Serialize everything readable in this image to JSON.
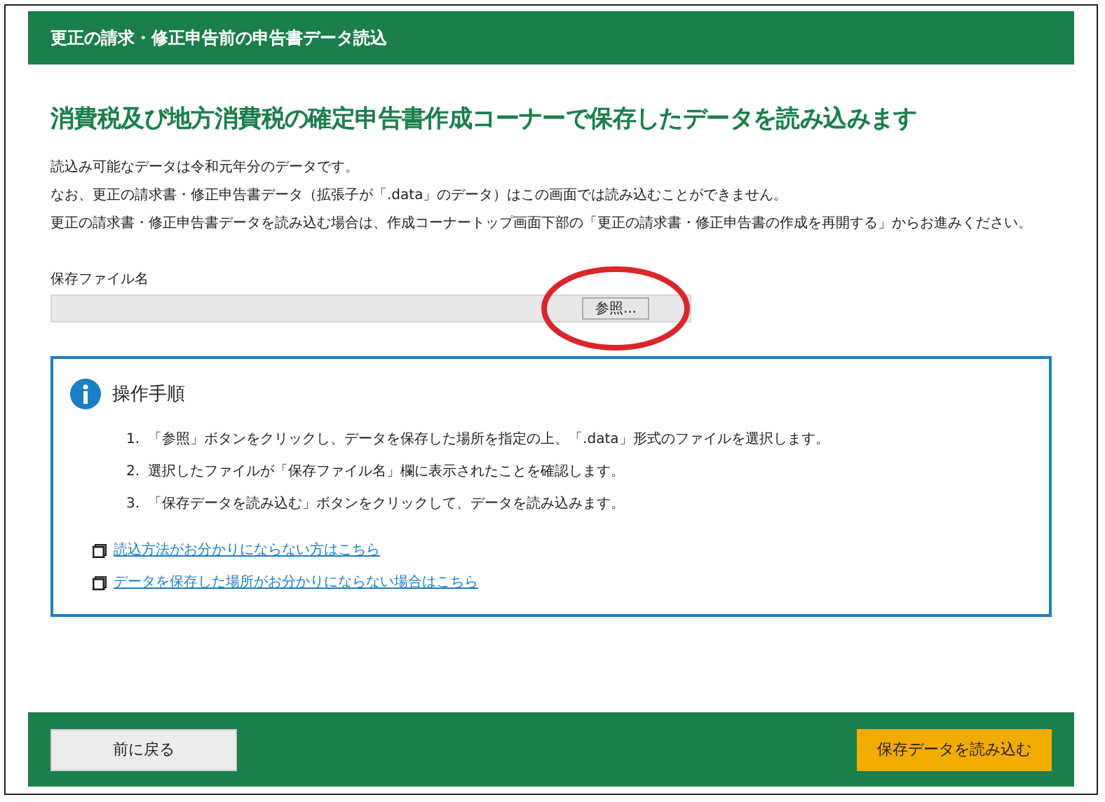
{
  "header": {
    "title": "更正の請求・修正申告前の申告書データ読込"
  },
  "heading": "消費税及び地方消費税の確定申告書作成コーナーで保存したデータを読み込みます",
  "notes": [
    "読込み可能なデータは令和元年分のデータです。",
    "なお、更正の請求書・修正申告書データ（拡張子が「.data」のデータ）はこの画面では読み込むことができません。",
    "更正の請求書・修正申告書データを読み込む場合は、作成コーナートップ画面下部の「更正の請求書・修正申告書の作成を再開する」からお進みください。"
  ],
  "file_field": {
    "label": "保存ファイル名",
    "browse_button": "参照...",
    "highlighted": true
  },
  "instructions": {
    "title": "操作手順",
    "steps": [
      {
        "number": "1.",
        "text": "「参照」ボタンをクリックし、データを保存した場所を指定の上、「.data」形式のファイルを選択します。"
      },
      {
        "number": "2.",
        "text": "選択したファイルが「保存ファイル名」欄に表示されたことを確認します。"
      },
      {
        "number": "3.",
        "text": "「保存データを読み込む」ボタンをクリックして、データを読み込みます。"
      }
    ],
    "links": [
      "読込方法がお分かりにならない方はこちら",
      "データを保存した場所がお分かりにならない場合はこちら"
    ]
  },
  "footer": {
    "back_button": "前に戻る",
    "load_button": "保存データを読み込む"
  }
}
